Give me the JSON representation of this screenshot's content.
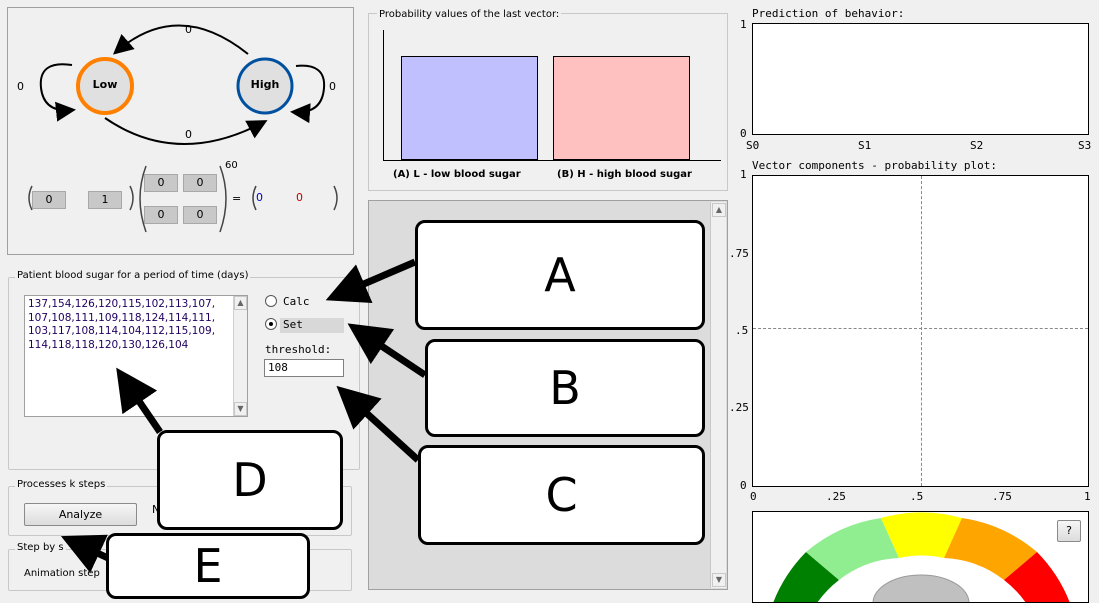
{
  "markov": {
    "low_label": "Low",
    "high_label": "High",
    "edge_top": "0",
    "edge_bottom": "0",
    "self_low": "0",
    "self_high": "0",
    "vector": [
      "0",
      "1"
    ],
    "matrix": [
      "0",
      "0",
      "0",
      "0"
    ],
    "exponent": "60",
    "equals": "=",
    "result": [
      "0",
      "0"
    ]
  },
  "bars": {
    "title": "Probability values of the last vector:",
    "label_a": "(A) L - low blood sugar",
    "label_b": "(B) H - high blood sugar",
    "colors": {
      "a": "#c0c0ff",
      "b": "#ffc0c0"
    }
  },
  "input_panel": {
    "title": "Patient blood sugar for a period of time (days)",
    "data_text": "137,154,126,120,115,102,113,107,\n107,108,111,109,118,124,114,111,\n103,117,108,114,104,112,115,109,\n114,118,118,120,130,126,104",
    "calc_label": "Calc",
    "set_label": "Set",
    "threshold_label": "threshold:",
    "threshold_value": "108"
  },
  "process": {
    "title": "Processes k steps",
    "analyze_label": "Analyze",
    "partial_text": "N"
  },
  "step": {
    "title": "Step by s",
    "animation_label": "Animation step"
  },
  "prediction": {
    "title": "Prediction of behavior:",
    "y_top": "1",
    "y_bottom": "0",
    "x_ticks": [
      "S0",
      "S1",
      "S2",
      "S3"
    ]
  },
  "vector_plot": {
    "title": "Vector components - probability plot:",
    "y_ticks": [
      "1",
      ".75",
      ".5",
      ".25",
      "0"
    ],
    "x_ticks": [
      "0",
      ".25",
      ".5",
      ".75",
      "1"
    ]
  },
  "gauge": {
    "help_label": "?",
    "colors": [
      "#008000",
      "#90ee90",
      "#ffff00",
      "#ffa500",
      "#ff0000"
    ]
  },
  "callouts": {
    "a": "A",
    "b": "B",
    "c": "C",
    "d": "D",
    "e": "E"
  }
}
